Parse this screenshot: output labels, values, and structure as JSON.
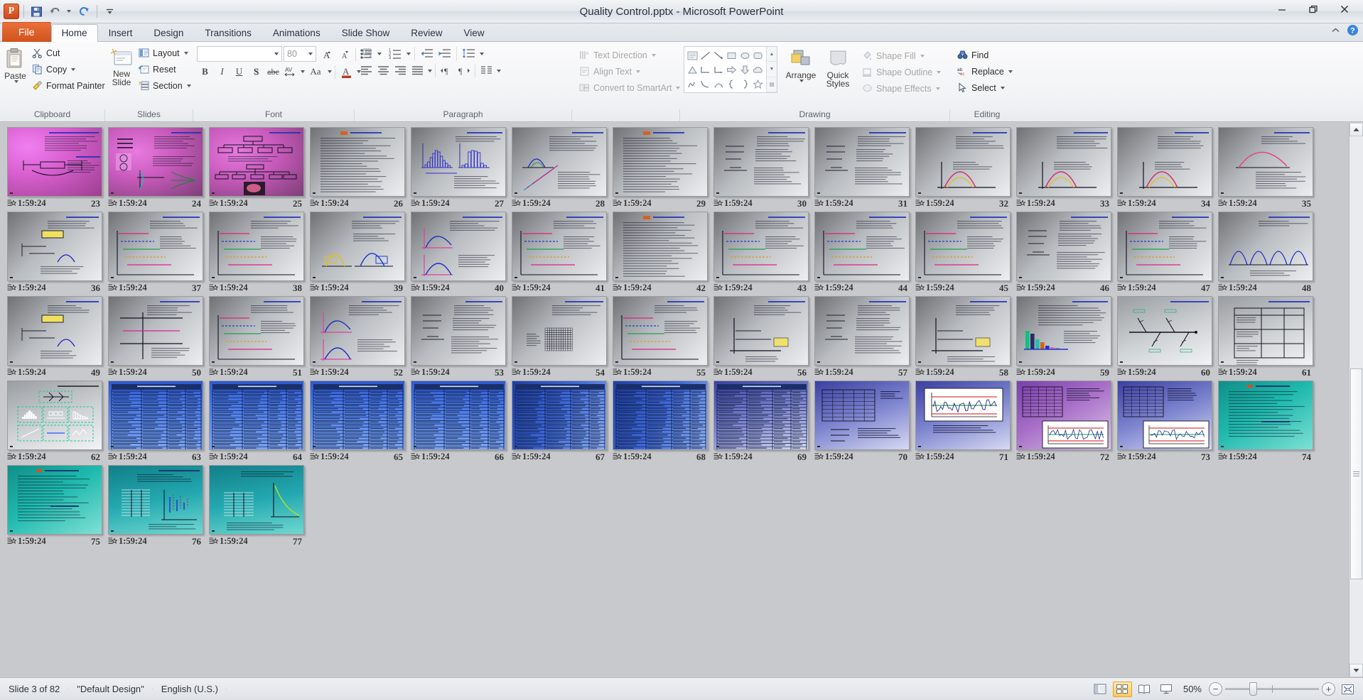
{
  "window": {
    "title": "Quality Control.pptx  -  Microsoft PowerPoint",
    "app_logo": "P",
    "minimize": "minimize-icon",
    "restore": "restore-icon",
    "close": "close-icon"
  },
  "quick_access": {
    "save": "save-icon",
    "undo": "undo-icon",
    "redo": "redo-icon",
    "customize": "customize-qat-icon"
  },
  "tabs": [
    {
      "label": "File",
      "active": false,
      "file": true
    },
    {
      "label": "Home",
      "active": true
    },
    {
      "label": "Insert",
      "active": false
    },
    {
      "label": "Design",
      "active": false
    },
    {
      "label": "Transitions",
      "active": false
    },
    {
      "label": "Animations",
      "active": false
    },
    {
      "label": "Slide Show",
      "active": false
    },
    {
      "label": "Review",
      "active": false
    },
    {
      "label": "View",
      "active": false
    }
  ],
  "ribbon": {
    "collapse": "collapse-ribbon-icon",
    "help": "help-icon",
    "groups": {
      "clipboard": {
        "label": "Clipboard",
        "paste": "Paste",
        "cut": "Cut",
        "copy": "Copy",
        "format_painter": "Format Painter"
      },
      "slides": {
        "label": "Slides",
        "new_slide": "New\nSlide",
        "new_slide_line1": "New",
        "new_slide_line2": "Slide",
        "layout": "Layout",
        "reset": "Reset",
        "section": "Section"
      },
      "font": {
        "label": "Font",
        "font_name": "",
        "font_size": "80",
        "bold": "B",
        "italic": "I",
        "underline": "U",
        "shadow": "S",
        "strikethrough": "abc",
        "char_spacing": "AV",
        "change_case": "Aa",
        "font_color": "A",
        "grow_font": "A",
        "shrink_font": "A",
        "clear_formatting": "clear-formatting-icon"
      },
      "paragraph": {
        "label": "Paragraph",
        "bullets": "bullets-icon",
        "numbering": "numbering-icon",
        "decrease_indent": "decrease-indent-icon",
        "increase_indent": "increase-indent-icon",
        "line_spacing": "line-spacing-icon",
        "align_left": "align-left-icon",
        "align_center": "align-center-icon",
        "align_right": "align-right-icon",
        "justify": "justify-icon",
        "ltr": "text-direction-ltr-icon",
        "rtl": "text-direction-rtl-icon",
        "columns": "columns-icon",
        "text_direction": "Text Direction",
        "align_text": "Align Text",
        "convert_to_smartart": "Convert to SmartArt"
      },
      "drawing": {
        "label": "Drawing",
        "arrange": "Arrange",
        "quick_styles_line1": "Quick",
        "quick_styles_line2": "Styles",
        "shape_fill": "Shape Fill",
        "shape_outline": "Shape Outline",
        "shape_effects": "Shape Effects"
      },
      "editing": {
        "label": "Editing",
        "find": "Find",
        "replace": "Replace",
        "select": "Select"
      }
    }
  },
  "status_bar": {
    "slide_indicator": "Slide 3 of 82",
    "theme": "\"Default Design\"",
    "language": "English (U.S.)",
    "zoom_level": "50%",
    "zoom_out": "−",
    "zoom_in": "+",
    "views": [
      {
        "name": "normal-view",
        "on": false
      },
      {
        "name": "slide-sorter-view",
        "on": true
      },
      {
        "name": "reading-view",
        "on": false
      },
      {
        "name": "slide-show-view",
        "on": false
      }
    ],
    "fit_to_window": "fit-slide-to-window-icon"
  },
  "sorter": {
    "transition_icon": "transition-star-icon",
    "timing": "1:59:24",
    "slides": [
      {
        "num": "23",
        "bg": "bg-magenta",
        "kind": "diagram-text"
      },
      {
        "num": "24",
        "bg": "bg-magenta2",
        "kind": "curves-text"
      },
      {
        "num": "25",
        "bg": "bg-magenta2",
        "kind": "orgchart-photo"
      },
      {
        "num": "26",
        "bg": "bg-gray",
        "kind": "text-dense"
      },
      {
        "num": "27",
        "bg": "bg-gray",
        "kind": "histograms"
      },
      {
        "num": "28",
        "bg": "bg-gray",
        "kind": "scatter-lines"
      },
      {
        "num": "29",
        "bg": "bg-gray",
        "kind": "text-dense"
      },
      {
        "num": "30",
        "bg": "bg-gray",
        "kind": "formula-text"
      },
      {
        "num": "31",
        "bg": "bg-gray",
        "kind": "formula-text"
      },
      {
        "num": "32",
        "bg": "bg-gray",
        "kind": "bell-curve"
      },
      {
        "num": "33",
        "bg": "bg-gray",
        "kind": "bell-curve"
      },
      {
        "num": "34",
        "bg": "bg-gray",
        "kind": "bell-curve"
      },
      {
        "num": "35",
        "bg": "bg-gray",
        "kind": "pink-curve"
      },
      {
        "num": "36",
        "bg": "bg-gray",
        "kind": "box-diagram"
      },
      {
        "num": "37",
        "bg": "bg-gray",
        "kind": "step-chart"
      },
      {
        "num": "38",
        "bg": "bg-gray",
        "kind": "step-chart"
      },
      {
        "num": "39",
        "bg": "bg-gray",
        "kind": "twin-peaks"
      },
      {
        "num": "40",
        "bg": "bg-gray",
        "kind": "twin-curves"
      },
      {
        "num": "41",
        "bg": "bg-gray",
        "kind": "step-chart"
      },
      {
        "num": "42",
        "bg": "bg-gray",
        "kind": "text-dense"
      },
      {
        "num": "43",
        "bg": "bg-gray",
        "kind": "step-chart"
      },
      {
        "num": "44",
        "bg": "bg-gray",
        "kind": "step-chart"
      },
      {
        "num": "45",
        "bg": "bg-gray",
        "kind": "step-chart"
      },
      {
        "num": "46",
        "bg": "bg-gray",
        "kind": "formula-text"
      },
      {
        "num": "47",
        "bg": "bg-gray",
        "kind": "step-chart"
      },
      {
        "num": "48",
        "bg": "bg-gray",
        "kind": "multi-peaks"
      },
      {
        "num": "49",
        "bg": "bg-gray",
        "kind": "box-diagram"
      },
      {
        "num": "50",
        "bg": "bg-gray",
        "kind": "cross-axes"
      },
      {
        "num": "51",
        "bg": "bg-gray",
        "kind": "step-chart"
      },
      {
        "num": "52",
        "bg": "bg-gray",
        "kind": "twin-curves"
      },
      {
        "num": "53",
        "bg": "bg-gray",
        "kind": "formula-text"
      },
      {
        "num": "54",
        "bg": "bg-gray",
        "kind": "grid-table"
      },
      {
        "num": "55",
        "bg": "bg-gray",
        "kind": "step-chart"
      },
      {
        "num": "56",
        "bg": "bg-gray",
        "kind": "axes-note"
      },
      {
        "num": "57",
        "bg": "bg-gray",
        "kind": "formula-text"
      },
      {
        "num": "58",
        "bg": "bg-gray",
        "kind": "axes-note"
      },
      {
        "num": "59",
        "bg": "bg-gray",
        "kind": "bar-chart"
      },
      {
        "num": "60",
        "bg": "bg-gray2",
        "kind": "fishbone"
      },
      {
        "num": "61",
        "bg": "bg-gray2",
        "kind": "table3"
      },
      {
        "num": "62",
        "bg": "bg-gray2",
        "kind": "seven-tools"
      },
      {
        "num": "63",
        "bg": "bg-blue",
        "kind": "blue-table"
      },
      {
        "num": "64",
        "bg": "bg-blue",
        "kind": "blue-table"
      },
      {
        "num": "65",
        "bg": "bg-blue",
        "kind": "blue-table"
      },
      {
        "num": "66",
        "bg": "bg-blue",
        "kind": "blue-table"
      },
      {
        "num": "67",
        "bg": "bg-blue2",
        "kind": "blue-table"
      },
      {
        "num": "68",
        "bg": "bg-blue2",
        "kind": "blue-table"
      },
      {
        "num": "69",
        "bg": "bg-blueviolet",
        "kind": "blue-table"
      },
      {
        "num": "70",
        "bg": "bg-blueviolet",
        "kind": "table-formula"
      },
      {
        "num": "71",
        "bg": "bg-blueviolet",
        "kind": "control-chart"
      },
      {
        "num": "72",
        "bg": "bg-purple",
        "kind": "table-control"
      },
      {
        "num": "73",
        "bg": "bg-blueviolet",
        "kind": "table-control"
      },
      {
        "num": "74",
        "bg": "bg-teal",
        "kind": "teal-text"
      },
      {
        "num": "75",
        "bg": "bg-teal",
        "kind": "teal-text"
      },
      {
        "num": "76",
        "bg": "bg-teal2",
        "kind": "teal-chart"
      },
      {
        "num": "77",
        "bg": "bg-teal2",
        "kind": "teal-curve"
      }
    ]
  }
}
